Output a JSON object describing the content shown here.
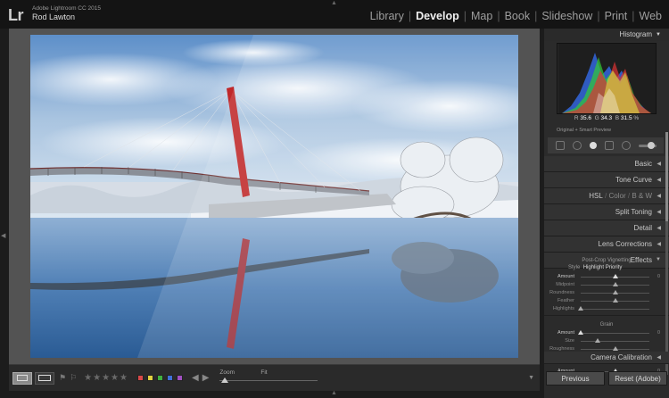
{
  "app": {
    "logo": "Lr",
    "version": "Adobe Lightroom CC 2015",
    "user": "Rod Lawton"
  },
  "modules": [
    {
      "label": "Library",
      "active": false
    },
    {
      "label": "Develop",
      "active": true
    },
    {
      "label": "Map",
      "active": false
    },
    {
      "label": "Book",
      "active": false
    },
    {
      "label": "Slideshow",
      "active": false
    },
    {
      "label": "Print",
      "active": false
    },
    {
      "label": "Web",
      "active": false
    }
  ],
  "toolbar": {
    "zoom_label": "Zoom",
    "fit_label": "Fit",
    "stars": "★★★★★",
    "color_labels": [
      "#d84848",
      "#e0d040",
      "#40b040",
      "#4070d8",
      "#a050c0"
    ],
    "prev_arrow": "◀",
    "next_arrow": "▶"
  },
  "histogram": {
    "title": "Histogram",
    "r_label": "R",
    "r_value": "35.6",
    "g_label": "G",
    "g_value": "34.3",
    "b_label": "B",
    "b_value": "31.5",
    "percent": "%",
    "preview_label": "Original + Smart Preview"
  },
  "panels": {
    "basic": "Basic",
    "tone_curve": "Tone Curve",
    "hsl": "HSL",
    "color": "Color",
    "bw": "B & W",
    "split_toning": "Split Toning",
    "detail": "Detail",
    "lens_corrections": "Lens Corrections",
    "effects": "Effects",
    "camera_calibration": "Camera Calibration"
  },
  "effects": {
    "vignette_title": "Post-Crop Vignetting",
    "style_label": "Style",
    "style_value": "Highlight Priority",
    "vignette_rows": [
      {
        "label": "Amount",
        "value": "0",
        "pos": 0.5,
        "active": true
      },
      {
        "label": "Midpoint",
        "value": "",
        "pos": 0.5,
        "active": false
      },
      {
        "label": "Roundness",
        "value": "",
        "pos": 0.5,
        "active": false
      },
      {
        "label": "Feather",
        "value": "",
        "pos": 0.5,
        "active": false
      },
      {
        "label": "Highlights",
        "value": "",
        "pos": 0.0,
        "active": false
      }
    ],
    "grain_title": "Grain",
    "grain_rows": [
      {
        "label": "Amount",
        "value": "0",
        "pos": 0.0,
        "active": true
      },
      {
        "label": "Size",
        "value": "",
        "pos": 0.25,
        "active": false
      },
      {
        "label": "Roughness",
        "value": "",
        "pos": 0.5,
        "active": false
      }
    ],
    "dehaze_title": "Dehaze",
    "dehaze_rows": [
      {
        "label": "Amount",
        "value": "0",
        "pos": 0.5,
        "active": true
      }
    ]
  },
  "buttons": {
    "previous": "Previous",
    "reset": "Reset (Adobe)"
  }
}
